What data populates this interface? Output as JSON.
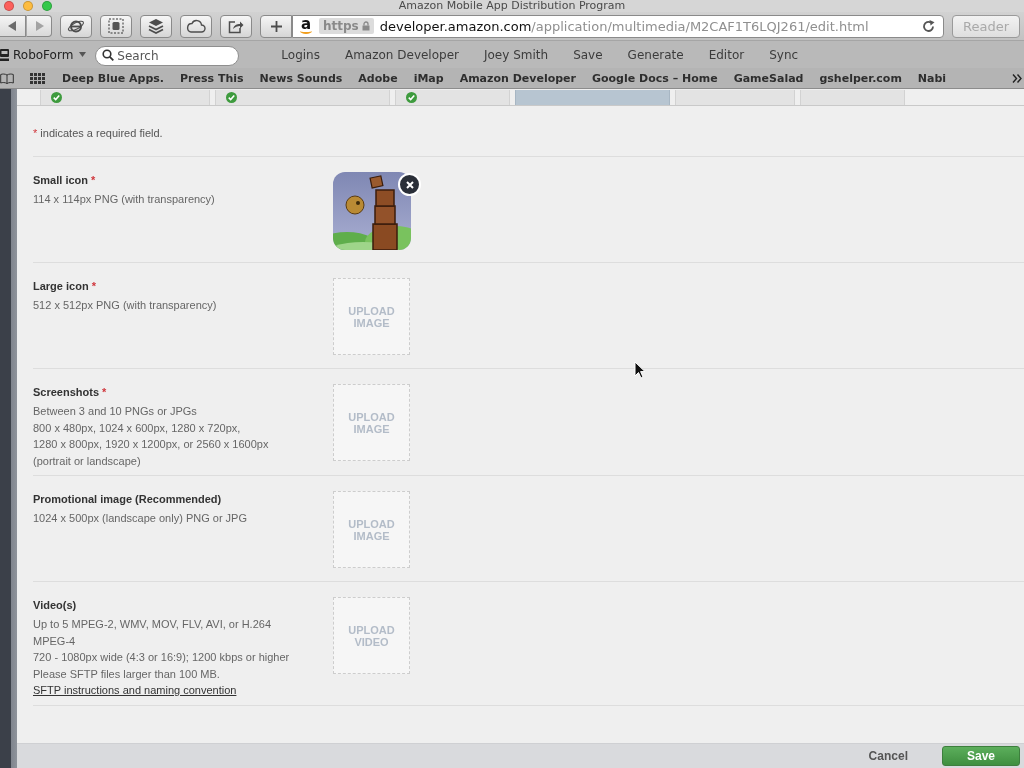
{
  "window": {
    "title": "Amazon Mobile App Distribution Program"
  },
  "toolbar": {
    "address": {
      "favicon": "a",
      "scheme": "https",
      "host": "developer.amazon.com",
      "path": "/application/multimedia/M2CAF1T6LQJ261/edit.html"
    },
    "reader_button": "Reader"
  },
  "roboform_bar": {
    "name": "RoboForm",
    "search": {
      "placeholder": "Search"
    },
    "items": [
      "Logins",
      "Amazon Developer",
      "Joey Smith",
      "Save",
      "Generate",
      "Editor",
      "Sync"
    ]
  },
  "bookmarks_bar": {
    "items": [
      "Deep Blue Apps.",
      "Press This",
      "News Sounds",
      "Adobe",
      "iMap",
      "Amazon Developer",
      "Google Docs – Home",
      "GameSalad",
      "gshelper.com",
      "Nabi"
    ]
  },
  "tabs": [
    {
      "selected": false,
      "complete": true
    },
    {
      "selected": false,
      "complete": true
    },
    {
      "selected": false,
      "complete": true
    },
    {
      "selected": true,
      "complete": false
    },
    {
      "selected": false,
      "complete": false
    },
    {
      "selected": false,
      "complete": false
    }
  ],
  "form": {
    "required_note": {
      "mark": "*",
      "text": "indicates a required field."
    },
    "fields": [
      {
        "label": "Small icon",
        "required_mark": "*",
        "lines": [
          "114 x 114px PNG (with transparency)"
        ],
        "upload": {
          "kind": "thumbnail"
        }
      },
      {
        "label": "Large icon",
        "required_mark": "*",
        "lines": [
          "512 x 512px PNG (with transparency)"
        ],
        "upload": {
          "kind": "dropzone",
          "text": "UPLOAD IMAGE"
        }
      },
      {
        "label": "Screenshots",
        "required_mark": "*",
        "lines": [
          "Between 3 and 10 PNGs or JPGs",
          "800 x 480px, 1024 x 600px, 1280 x 720px,",
          "1280 x 800px, 1920 x 1200px, or 2560 x 1600px",
          "(portrait or landscape)"
        ],
        "upload": {
          "kind": "dropzone",
          "text": "UPLOAD IMAGE"
        }
      },
      {
        "label": "Promotional image (Recommended)",
        "lines": [
          "1024 x 500px (landscape only) PNG or JPG"
        ],
        "upload": {
          "kind": "dropzone",
          "text": "UPLOAD IMAGE"
        }
      },
      {
        "label": "Video(s)",
        "lines": [
          "Up to 5 MPEG-2, WMV, MOV, FLV, AVI, or H.264",
          "MPEG-4",
          "720 - 1080px wide (4:3 or 16:9); 1200 kbps or higher",
          "Please SFTP files larger than 100 MB."
        ],
        "link": "SFTP instructions and naming convention",
        "upload": {
          "kind": "dropzone",
          "text": "UPLOAD VIDEO"
        }
      }
    ]
  },
  "footer": {
    "buttons": [
      {
        "label": "Cancel",
        "kind": "plain"
      },
      {
        "label": "Save",
        "kind": "primary"
      }
    ]
  }
}
